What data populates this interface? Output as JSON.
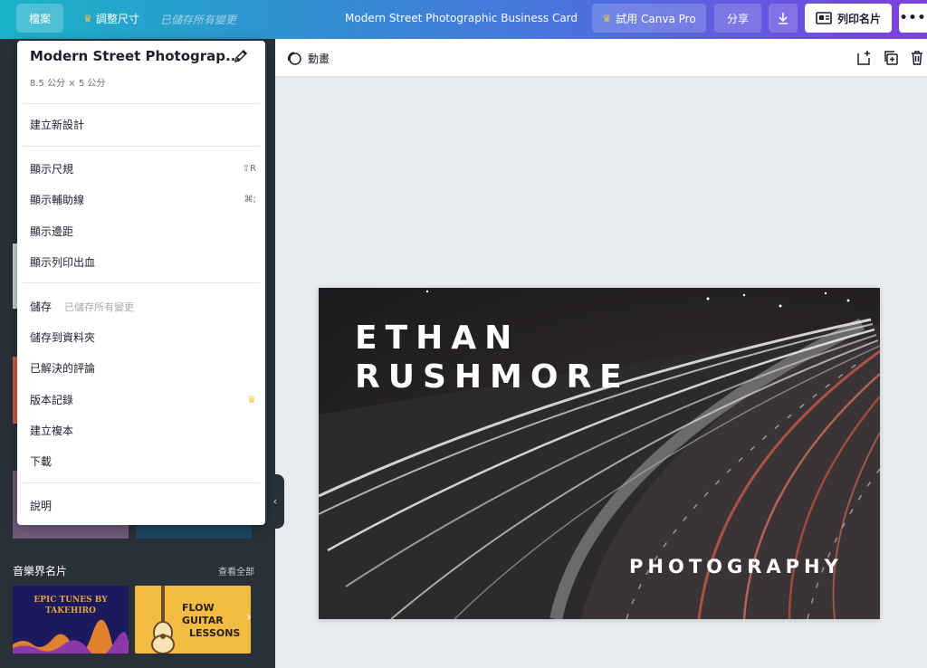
{
  "topbar": {
    "file_label": "檔案",
    "resize_label": "調整尺寸",
    "saved_status": "已儲存所有變更",
    "doc_title": "Modern Street Photographic Business Card",
    "try_pro_label": "試用 Canva Pro",
    "share_label": "分享",
    "print_label": "列印名片",
    "more_label": "•••"
  },
  "menu": {
    "title": "Modern Street Photograp...",
    "dimensions": "8.5 公分 × 5 公分",
    "new_design": "建立新設計",
    "show_rulers": "顯示尺規",
    "show_rulers_shortcut": "⇧R",
    "show_guides": "顯示輔助線",
    "show_guides_shortcut": "⌘;",
    "show_margins": "顯示邊距",
    "show_bleed": "顯示列印出血",
    "save": "儲存",
    "save_status": "已儲存所有變更",
    "save_to_folder": "儲存到資料夾",
    "resolved_comments": "已解決的評論",
    "version_history": "版本記錄",
    "make_copy": "建立複本",
    "download": "下載",
    "help": "說明"
  },
  "canvas_toolbar": {
    "animate_label": "動畫"
  },
  "sidepanel": {
    "section_title": "音樂界名片",
    "see_all": "查看全部",
    "template1_text": "EPIC TUNES BY TAKEHIRO",
    "template2_line1": "FLOW GUITAR",
    "template2_line2": "LESSONS"
  },
  "card": {
    "name_line1": "ETHAN",
    "name_line2": "RUSHMORE",
    "tagline": "PHOTOGRAPHY"
  },
  "colors": {
    "accent_crown": "#f6c343",
    "sidebar_bg": "#293039",
    "canvas_bg": "#e9ecef"
  }
}
